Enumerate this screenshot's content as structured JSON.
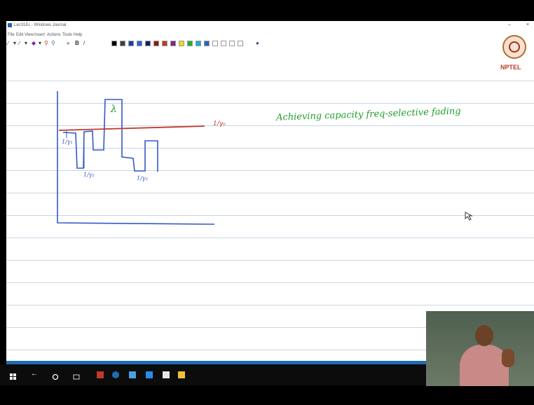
{
  "window": {
    "title": "Lec31Ec - Windows Journal",
    "menu": [
      "File",
      "Edit",
      "View",
      "Insert",
      "Actions",
      "Tools",
      "Help"
    ]
  },
  "toolbar": {
    "color_swatches": [
      "#000000",
      "#404040",
      "#1a3fa8",
      "#2a5fd0",
      "#1a1a6a",
      "#8a1a1a",
      "#c0392b",
      "#7a2a8a",
      "#e8e01a",
      "#27a83a",
      "#1ab0d0",
      "#2a60c0",
      "#ffffff",
      "#ffffff",
      "#ffffff",
      "#ffffff"
    ]
  },
  "logo": {
    "text": "NPTEL"
  },
  "note": {
    "heading": "Achieving capacity freq-selective fading",
    "label_water_level": "1/γ₀",
    "label_1": "1/γ₁",
    "label_2": "1/γ₂",
    "label_3": "1/γ₃",
    "label_lambda": "λ"
  },
  "colors": {
    "ink_blue": "#3558c8",
    "ink_red": "#c0392b",
    "ink_green": "#1f9d2a",
    "accent": "#1f6cb5"
  }
}
